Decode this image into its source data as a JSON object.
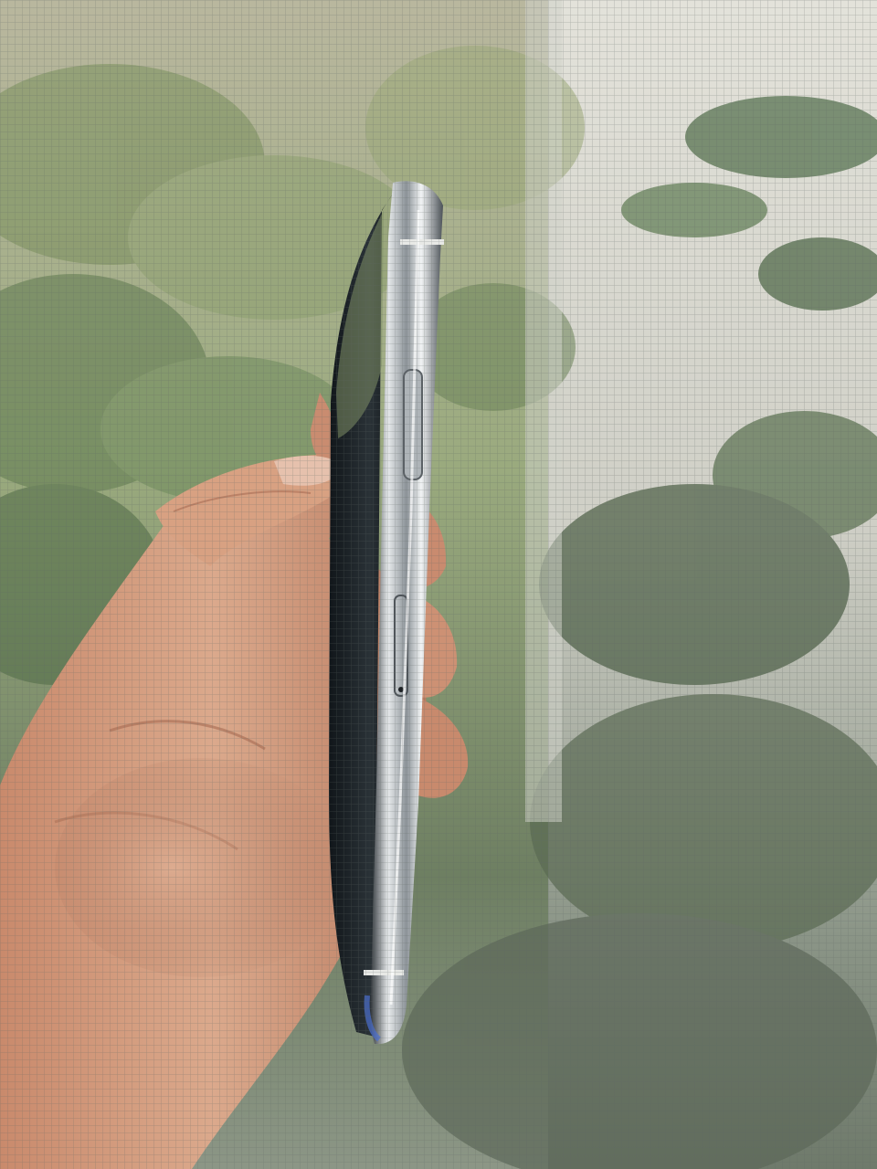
{
  "scene": {
    "subject": "phone-side-view-held-in-hand",
    "colors": {
      "foliage_light": "#b9c4a8",
      "foliage_dark": "#3f5a3a",
      "wall": "#d9d8d0",
      "skin": "#d29a7c",
      "skin_shadow": "#a86a52",
      "steel": "#cfd3d6",
      "steel_dark": "#3a3f45",
      "glass": "#1e2326"
    },
    "icons": [
      "screen-mesh-overlay",
      "side-button-icon",
      "sim-tray-icon"
    ]
  }
}
